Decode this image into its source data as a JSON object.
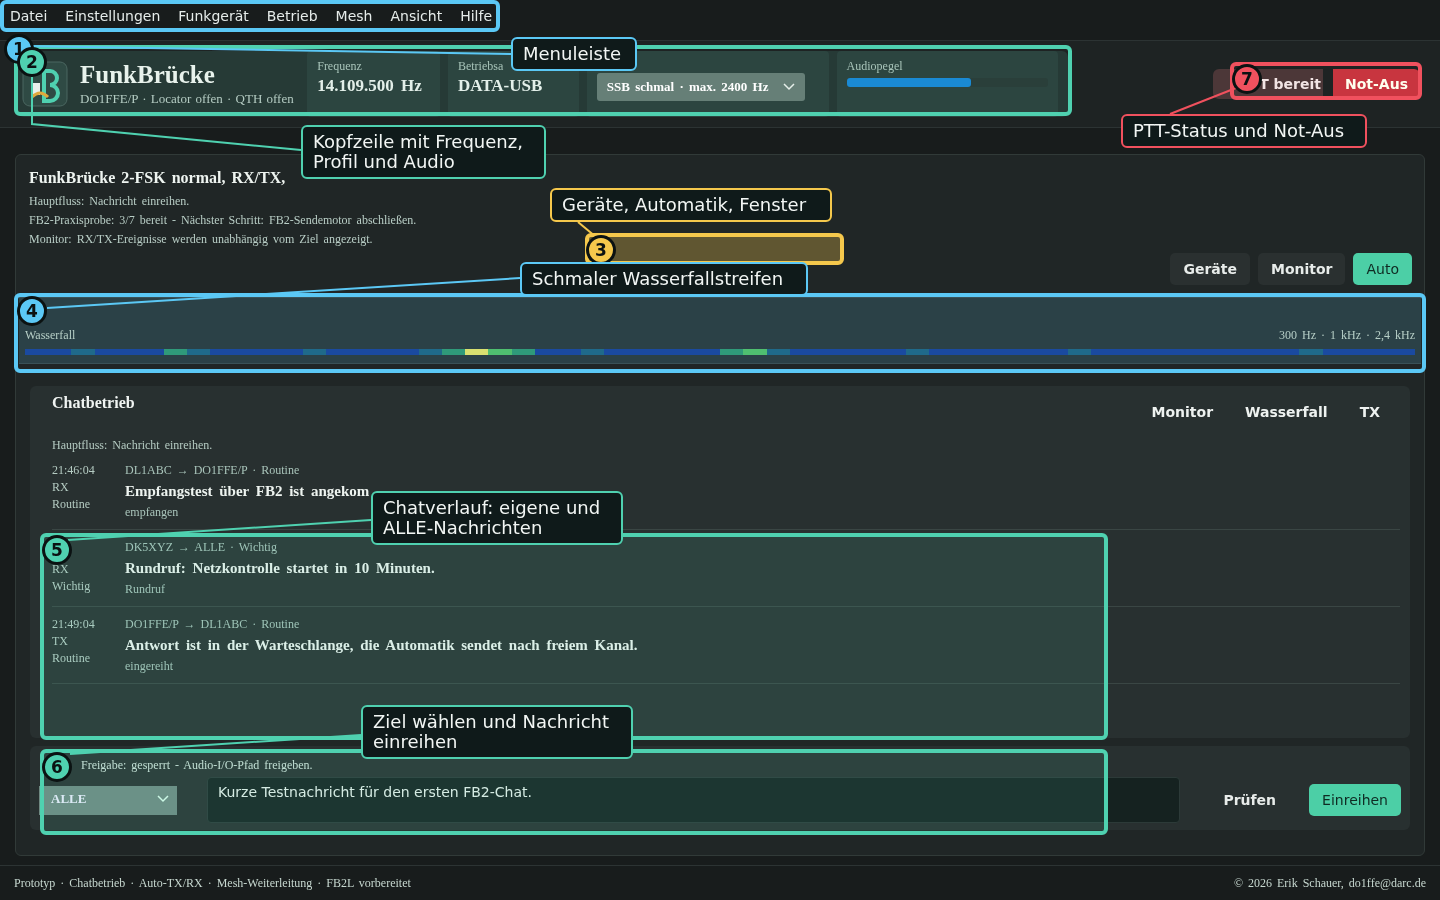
{
  "menu": [
    "Datei",
    "Einstellungen",
    "Funkgerät",
    "Betrieb",
    "Mesh",
    "Ansicht",
    "Hilfe"
  ],
  "header": {
    "app_name": "FunkBrücke",
    "station_line": "DO1FFE/P · Locator offen · QTH offen",
    "fields": [
      {
        "label": "Frequenz",
        "value": "14.109.500 Hz"
      },
      {
        "label": "Betriebsa",
        "value": "DATA-USB"
      }
    ],
    "profile_select": {
      "value": "SSB schmal · max. 2400 Hz"
    },
    "audio": {
      "label": "Audiopegel",
      "level": 0.62
    }
  },
  "ptt": {
    "status": "T bereit",
    "emergency_button": "Not-Aus"
  },
  "overview": {
    "title": "FunkBrücke 2-FSK normal, RX/TX,",
    "lines": [
      "Hauptfluss: Nachricht einreihen.",
      "FB2-Praxisprobe: 3/7 bereit - Nächster Schritt: FB2-Sendemotor abschließen.",
      "Monitor: RX/TX-Ereignisse werden unabhängig vom Ziel angezeigt."
    ],
    "buttons": [
      {
        "label": "Geräte",
        "selected": false
      },
      {
        "label": "Monitor",
        "selected": false
      },
      {
        "label": "Auto",
        "selected": true
      }
    ]
  },
  "waterfall": {
    "label": "Wasserfall",
    "scale": "300 Hz · 1 kHz · 2,4 kHz"
  },
  "chat": {
    "title": "Chatbetrieb",
    "tabs": [
      "Monitor",
      "Wasserfall",
      "TX"
    ],
    "subtitle": "Hauptfluss: Nachricht einreihen.",
    "messages": [
      {
        "meta": [
          "21:46:04",
          "RX",
          "Routine"
        ],
        "route": "DL1ABC → DO1FFE/P · Routine",
        "text": "Empfangstest über FB2 ist angekom",
        "status": "empfangen"
      },
      {
        "meta": [
          "RX",
          "Wichtig"
        ],
        "route": "DK5XYZ → ALLE · Wichtig",
        "text": "Rundruf: Netzkontrolle startet in 10 Minuten.",
        "status": "Rundruf"
      },
      {
        "meta": [
          "21:49:04",
          "TX",
          "Routine"
        ],
        "route": "DO1FFE/P → DL1ABC · Routine",
        "text": "Antwort ist in der Warteschlange, die Automatik sendet nach freiem Kanal.",
        "status": "eingereiht"
      }
    ]
  },
  "compose": {
    "notice": "Freigabe: gesperrt - Audio-I/O-Pfad freigeben.",
    "target": "ALLE",
    "message": "Kurze Testnachricht für den ersten FB2-Chat.",
    "buttons": [
      {
        "label": "Prüfen",
        "kind": "secondary"
      },
      {
        "label": "Einreihen",
        "kind": "primary"
      }
    ]
  },
  "footer": {
    "left": "Prototyp · Chatbetrieb · Auto-TX/RX · Mesh-Weiterleitung · FB2L vorbereitet",
    "right": "© 2026 Erik Schauer, do1ffe@darc.de"
  },
  "annotations": [
    {
      "number": "1",
      "label": "Menuleiste",
      "color": "#5bc8f5"
    },
    {
      "number": "2",
      "label": "Kopfzeile mit Frequenz, Profil und Audio",
      "color": "#4fd1b0"
    },
    {
      "number": "3",
      "label": "Geräte, Automatik, Fenster",
      "color": "#f5c84c"
    },
    {
      "number": "4",
      "label": "Schmaler Wasserfallstreifen",
      "color": "#5bc8f5"
    },
    {
      "number": "5",
      "label": "Chatverlauf: eigene und ALLE-Nachrichten",
      "color": "#4fd1b0"
    },
    {
      "number": "6",
      "label": "Ziel wählen und Nachricht einreihen",
      "color": "#4fd1b0"
    },
    {
      "number": "7",
      "label": "PTT-Status und Not-Aus",
      "color": "#f0515e"
    }
  ]
}
